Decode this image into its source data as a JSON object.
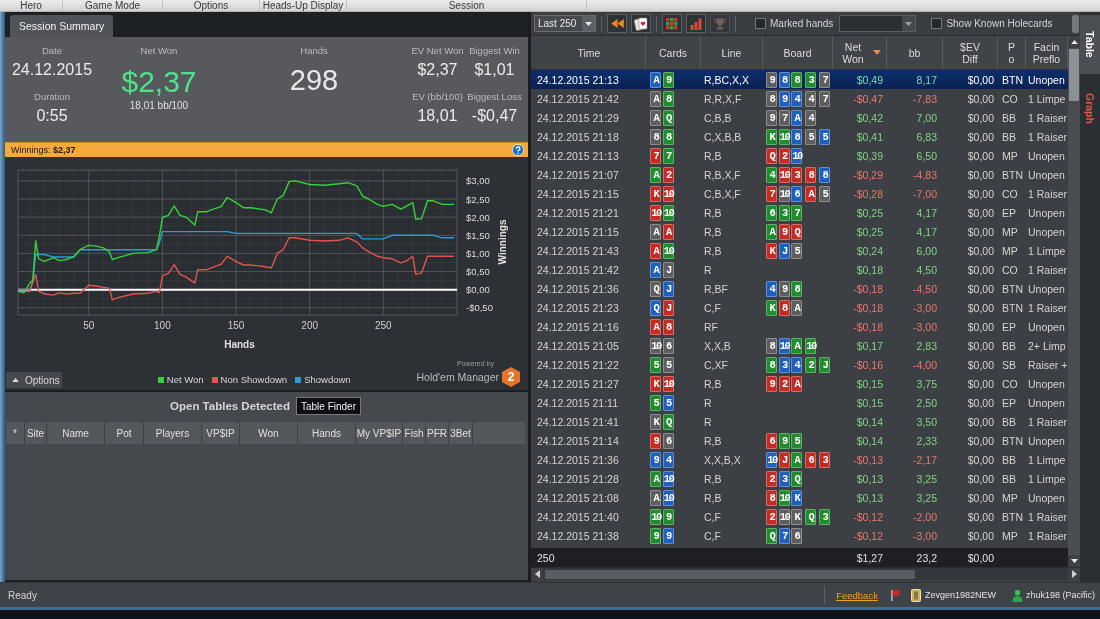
{
  "menu": [
    "Hero",
    "Game Mode",
    "Options",
    "Heads-Up Display",
    "Session"
  ],
  "tabs": [
    {
      "label": "Session Summary",
      "selected": true
    }
  ],
  "summary": {
    "date": {
      "label": "Date",
      "value": "24.12.2015"
    },
    "duration": {
      "label": "Duration",
      "value": "0:55"
    },
    "net_won": {
      "label": "Net Won",
      "value": "$2,37",
      "rate": "18,01 bb/100"
    },
    "hands": {
      "label": "Hands",
      "value": "298"
    },
    "ev_net_won": {
      "label": "EV Net Won",
      "value": "$2,37"
    },
    "ev_bb_100": {
      "label": "EV (bb/100)",
      "value": "18,01"
    },
    "biggest_win": {
      "label": "Biggest Win",
      "value": "$1,01"
    },
    "biggest_loss": {
      "label": "Biggest Loss",
      "value": "-$0,47"
    }
  },
  "winnings_bar": {
    "text": "Winnings: **$2,37**"
  },
  "chart": {
    "chart_data": {
      "type": "line",
      "xlabel": "Hands",
      "ylabel": "Winnings",
      "grid": true,
      "x": [
        2,
        6,
        10,
        12,
        14,
        16,
        20,
        26,
        30,
        35,
        40,
        44,
        50,
        55,
        60,
        64,
        66,
        70,
        80,
        90,
        96,
        98,
        100,
        104,
        108,
        112,
        116,
        122,
        124,
        130,
        140,
        144,
        150,
        155,
        160,
        170,
        174,
        178,
        182,
        186,
        190,
        200,
        210,
        220,
        226,
        232,
        236,
        240,
        246,
        250,
        256,
        262,
        266,
        270,
        272,
        276,
        280,
        284,
        290,
        298
      ],
      "series": [
        {
          "name": "Net Won",
          "color": "#35d13a",
          "values": [
            -0.05,
            -0.09,
            0.18,
            0.25,
            1.35,
            0.85,
            0.78,
            0.88,
            0.8,
            0.83,
            0.92,
            1.1,
            1.22,
            1.2,
            1.15,
            1.05,
            0.83,
            0.88,
            1.0,
            1.02,
            1.1,
            1.48,
            1.99,
            2.05,
            2.31,
            2.05,
            2.0,
            1.78,
            2.15,
            2.15,
            2.3,
            2.54,
            2.4,
            2.26,
            2.26,
            2.2,
            2.12,
            2.5,
            2.6,
            2.98,
            3.0,
            2.9,
            2.88,
            2.92,
            2.95,
            2.86,
            2.58,
            2.5,
            2.35,
            2.3,
            2.35,
            2.22,
            2.31,
            2.4,
            1.94,
            1.96,
            2.45,
            2.45,
            2.35,
            2.35
          ]
        },
        {
          "name": "Non Showdown",
          "color": "#e0554f",
          "values": [
            -0.05,
            -0.05,
            -0.05,
            0.2,
            0.42,
            -0.05,
            -0.12,
            -0.15,
            -0.09,
            -0.12,
            -0.1,
            -0.1,
            0.12,
            0.1,
            0.06,
            0.04,
            -0.28,
            -0.22,
            -0.12,
            -0.1,
            -0.05,
            -0.08,
            0.38,
            0.45,
            0.69,
            0.42,
            0.35,
            0.18,
            0.55,
            0.55,
            0.7,
            0.92,
            0.78,
            0.68,
            0.68,
            0.63,
            0.6,
            1.0,
            1.1,
            1.43,
            1.43,
            1.36,
            1.34,
            1.36,
            1.43,
            1.32,
            1.15,
            1.05,
            0.92,
            0.88,
            0.85,
            0.74,
            0.8,
            0.92,
            0.42,
            0.46,
            0.92,
            0.92,
            0.92,
            0.92
          ]
        },
        {
          "name": "Showdown",
          "color": "#2a9bd8",
          "values": [
            0,
            0,
            0,
            0.2,
            0.97,
            0.97,
            0.97,
            0.9,
            0.9,
            0.9,
            0.9,
            1.1,
            1.1,
            1.1,
            1.1,
            1.1,
            1.1,
            1.1,
            1.1,
            1.1,
            1.1,
            1.3,
            1.6,
            1.6,
            1.6,
            1.6,
            1.6,
            1.6,
            1.6,
            1.6,
            1.6,
            1.6,
            1.55,
            1.55,
            1.55,
            1.55,
            1.55,
            1.55,
            1.55,
            1.55,
            1.55,
            1.55,
            1.55,
            1.55,
            1.55,
            1.55,
            1.4,
            1.4,
            1.4,
            1.4,
            1.5,
            1.5,
            1.5,
            1.5,
            1.5,
            1.5,
            1.5,
            1.5,
            1.43,
            1.43
          ]
        }
      ],
      "xlim": [
        2,
        300
      ],
      "ylim": [
        -0.7,
        3.3
      ],
      "xticks": [
        50,
        100,
        150,
        200,
        250
      ],
      "yticks": [
        {
          "value": -0.5,
          "label": "-$0,50"
        },
        {
          "value": 0,
          "label": "$0,00"
        },
        {
          "value": 0.5,
          "label": "$0,50"
        },
        {
          "value": 1,
          "label": "$1,00"
        },
        {
          "value": 1.5,
          "label": "$1,50"
        },
        {
          "value": 2,
          "label": "$2,00"
        },
        {
          "value": 2.5,
          "label": "$2,50"
        },
        {
          "value": 3,
          "label": "$3,00"
        }
      ]
    },
    "options_button": {
      "label": "Options"
    },
    "branding": {
      "tagline": "Powered by",
      "name": "Hold'em Manager",
      "badge": "2"
    }
  },
  "open_tables": {
    "title": "Open Tables Detected",
    "finder_button": {
      "label": "Table Finder"
    },
    "columns": [
      "*",
      "Site",
      "Name",
      "Pot",
      "Players",
      "VP$IP",
      "Won",
      "Hands",
      "My VP$IP",
      "Fish",
      "PFR",
      "3Bet"
    ]
  },
  "hand_list": {
    "toolbar": {
      "range": {
        "value": "Last 250"
      },
      "icon_buttons": [
        {
          "disabled": false
        },
        {
          "disabled": false
        },
        {
          "disabled": false
        },
        {
          "disabled": false
        },
        {
          "disabled": true
        }
      ],
      "marked_hands": {
        "label": "Marked hands",
        "checked": false
      },
      "show_holecards": {
        "label": "Show Known Holecards",
        "checked": false
      }
    },
    "columns": [
      {
        "label": "Time",
        "sorted": false
      },
      {
        "label": "Cards",
        "sorted": false
      },
      {
        "label": "Line",
        "sorted": false
      },
      {
        "label": "Board",
        "sorted": false
      },
      {
        "label": "Net Won",
        "sorted": true
      },
      {
        "label": "bb",
        "sorted": false
      },
      {
        "label": "$EV Diff",
        "sorted": false
      },
      {
        "label": "Po",
        "sorted": false
      },
      {
        "label": "Facin Preflo",
        "sorted": false
      }
    ],
    "rows": [
      {
        "time": "24.12.2015 21:13",
        "hole_cards": [
          {
            "rank": "A",
            "color": "#1f5fbd"
          },
          {
            "rank": "9",
            "color": "#1f8d2b"
          }
        ],
        "line": "R,BC,X,X",
        "board": [
          {
            "rank": "9",
            "color": "#5e5e5e"
          },
          {
            "rank": "8",
            "color": "#1f5fbd"
          },
          {
            "rank": "8",
            "color": "#1f8d2b"
          },
          {
            "rank": "3",
            "color": "#1f8d2b"
          },
          {
            "rank": "7",
            "color": "#5e5e5e"
          }
        ],
        "net_won": "$0,49",
        "bb": "8,17",
        "ev_diff": "$0,00",
        "position": "BTN",
        "facing": "Unopen",
        "won": true,
        "selected": true
      },
      {
        "time": "24.12.2015 21:42",
        "hole_cards": [
          {
            "rank": "A",
            "color": "#5e5e5e"
          },
          {
            "rank": "8",
            "color": "#1f8d2b"
          }
        ],
        "line": "R,R,X,F",
        "board": [
          {
            "rank": "8",
            "color": "#5e5e5e"
          },
          {
            "rank": "9",
            "color": "#1f5fbd"
          },
          {
            "rank": "4",
            "color": "#1f5fbd"
          },
          {
            "rank": "4",
            "color": "#5e5e5e"
          },
          {
            "rank": "7",
            "color": "#5e5e5e"
          }
        ],
        "net_won": "-$0,47",
        "bb": "-7,83",
        "ev_diff": "$0,00",
        "position": "CO",
        "facing": "1 Limpe",
        "won": false,
        "selected": false
      },
      {
        "time": "24.12.2015 21:29",
        "hole_cards": [
          {
            "rank": "A",
            "color": "#5e5e5e"
          },
          {
            "rank": "Q",
            "color": "#1f8d2b"
          }
        ],
        "line": "C,B,B",
        "board": [
          {
            "rank": "9",
            "color": "#5e5e5e"
          },
          {
            "rank": "7",
            "color": "#5e5e5e"
          },
          {
            "rank": "A",
            "color": "#1f5fbd"
          },
          {
            "rank": "4",
            "color": "#5e5e5e"
          }
        ],
        "net_won": "$0,42",
        "bb": "7,00",
        "ev_diff": "$0,00",
        "position": "BB",
        "facing": "1 Raiser",
        "won": true,
        "selected": false
      },
      {
        "time": "24.12.2015 21:18",
        "hole_cards": [
          {
            "rank": "8",
            "color": "#5e5e5e"
          },
          {
            "rank": "8",
            "color": "#1f8d2b"
          }
        ],
        "line": "C,X,B,B",
        "board": [
          {
            "rank": "K",
            "color": "#1f8d2b"
          },
          {
            "rank": "10",
            "color": "#1f8d2b"
          },
          {
            "rank": "8",
            "color": "#1f5fbd"
          },
          {
            "rank": "5",
            "color": "#5e5e5e"
          },
          {
            "rank": "5",
            "color": "#1f5fbd"
          }
        ],
        "net_won": "$0,41",
        "bb": "6,83",
        "ev_diff": "$0,00",
        "position": "BB",
        "facing": "1 Raiser",
        "won": true,
        "selected": false
      },
      {
        "time": "24.12.2015 21:13",
        "hole_cards": [
          {
            "rank": "7",
            "color": "#c62b23"
          },
          {
            "rank": "7",
            "color": "#1f8d2b"
          }
        ],
        "line": "R,B",
        "board": [
          {
            "rank": "Q",
            "color": "#c62b23"
          },
          {
            "rank": "2",
            "color": "#c62b23"
          },
          {
            "rank": "10",
            "color": "#1f5fbd"
          }
        ],
        "net_won": "$0,39",
        "bb": "6,50",
        "ev_diff": "$0,00",
        "position": "MP",
        "facing": "Unopen",
        "won": true,
        "selected": false
      },
      {
        "time": "24.12.2015 21:07",
        "hole_cards": [
          {
            "rank": "A",
            "color": "#1f8d2b"
          },
          {
            "rank": "2",
            "color": "#c62b23"
          }
        ],
        "line": "R,B,X,F",
        "board": [
          {
            "rank": "4",
            "color": "#1f8d2b"
          },
          {
            "rank": "10",
            "color": "#c62b23"
          },
          {
            "rank": "3",
            "color": "#c62b23"
          },
          {
            "rank": "8",
            "color": "#c62b23"
          },
          {
            "rank": "8",
            "color": "#1f5fbd"
          }
        ],
        "net_won": "-$0,29",
        "bb": "-4,83",
        "ev_diff": "$0,00",
        "position": "BTN",
        "facing": "Unopen",
        "won": false,
        "selected": false
      },
      {
        "time": "24.12.2015 21:15",
        "hole_cards": [
          {
            "rank": "K",
            "color": "#c62b23"
          },
          {
            "rank": "10",
            "color": "#c62b23"
          }
        ],
        "line": "C,B,X,F",
        "board": [
          {
            "rank": "7",
            "color": "#c62b23"
          },
          {
            "rank": "10",
            "color": "#5e5e5e"
          },
          {
            "rank": "6",
            "color": "#1f5fbd"
          },
          {
            "rank": "A",
            "color": "#c62b23"
          },
          {
            "rank": "5",
            "color": "#5e5e5e"
          }
        ],
        "net_won": "-$0,28",
        "bb": "-7,00",
        "ev_diff": "$0,00",
        "position": "CO",
        "facing": "1 Raiser",
        "won": false,
        "selected": false
      },
      {
        "time": "24.12.2015 21:21",
        "hole_cards": [
          {
            "rank": "10",
            "color": "#c62b23"
          },
          {
            "rank": "10",
            "color": "#1f8d2b"
          }
        ],
        "line": "R,B",
        "board": [
          {
            "rank": "6",
            "color": "#1f8d2b"
          },
          {
            "rank": "3",
            "color": "#1f8d2b"
          },
          {
            "rank": "7",
            "color": "#1f8d2b"
          }
        ],
        "net_won": "$0,25",
        "bb": "4,17",
        "ev_diff": "$0,00",
        "position": "EP",
        "facing": "Unopen",
        "won": true,
        "selected": false
      },
      {
        "time": "24.12.2015 21:15",
        "hole_cards": [
          {
            "rank": "A",
            "color": "#5e5e5e"
          },
          {
            "rank": "A",
            "color": "#c62b23"
          }
        ],
        "line": "R,B",
        "board": [
          {
            "rank": "A",
            "color": "#1f8d2b"
          },
          {
            "rank": "9",
            "color": "#c62b23"
          },
          {
            "rank": "Q",
            "color": "#c62b23"
          }
        ],
        "net_won": "$0,25",
        "bb": "4,17",
        "ev_diff": "$0,00",
        "position": "MP",
        "facing": "Unopen",
        "won": true,
        "selected": false
      },
      {
        "time": "24.12.2015 21:43",
        "hole_cards": [
          {
            "rank": "A",
            "color": "#c62b23"
          },
          {
            "rank": "10",
            "color": "#1f8d2b"
          }
        ],
        "line": "R,B",
        "board": [
          {
            "rank": "K",
            "color": "#c62b23"
          },
          {
            "rank": "J",
            "color": "#1f5fbd"
          },
          {
            "rank": "5",
            "color": "#5e5e5e"
          }
        ],
        "net_won": "$0,24",
        "bb": "6,00",
        "ev_diff": "$0,00",
        "position": "MP",
        "facing": "1 Limpe",
        "won": true,
        "selected": false
      },
      {
        "time": "24.12.2015 21:42",
        "hole_cards": [
          {
            "rank": "A",
            "color": "#1f5fbd"
          },
          {
            "rank": "J",
            "color": "#5e5e5e"
          }
        ],
        "line": "R",
        "net_won": "$0,18",
        "bb": "4,50",
        "ev_diff": "$0,00",
        "position": "CO",
        "facing": "1 Raiser",
        "won": true,
        "selected": false
      },
      {
        "time": "24.12.2015 21:36",
        "hole_cards": [
          {
            "rank": "Q",
            "color": "#5e5e5e"
          },
          {
            "rank": "J",
            "color": "#1f5fbd"
          }
        ],
        "line": "R,BF",
        "board": [
          {
            "rank": "4",
            "color": "#1f5fbd"
          },
          {
            "rank": "9",
            "color": "#5e5e5e"
          },
          {
            "rank": "8",
            "color": "#1f8d2b"
          }
        ],
        "net_won": "-$0,18",
        "bb": "-4,50",
        "ev_diff": "$0,00",
        "position": "BTN",
        "facing": "Unopen",
        "won": false,
        "selected": false
      },
      {
        "time": "24.12.2015 21:23",
        "hole_cards": [
          {
            "rank": "Q",
            "color": "#1f5fbd"
          },
          {
            "rank": "J",
            "color": "#c62b23"
          }
        ],
        "line": "C,F",
        "board": [
          {
            "rank": "K",
            "color": "#1f8d2b"
          },
          {
            "rank": "8",
            "color": "#c62b23"
          },
          {
            "rank": "A",
            "color": "#5e5e5e"
          }
        ],
        "net_won": "-$0,18",
        "bb": "-3,00",
        "ev_diff": "$0,00",
        "position": "BTN",
        "facing": "1 Raiser",
        "won": false,
        "selected": false
      },
      {
        "time": "24.12.2015 21:16",
        "hole_cards": [
          {
            "rank": "A",
            "color": "#c62b23"
          },
          {
            "rank": "8",
            "color": "#c62b23"
          }
        ],
        "line": "RF",
        "net_won": "-$0,18",
        "bb": "-3,00",
        "ev_diff": "$0,00",
        "position": "EP",
        "facing": "Unopen",
        "won": false,
        "selected": false
      },
      {
        "time": "24.12.2015 21:05",
        "hole_cards": [
          {
            "rank": "10",
            "color": "#5e5e5e"
          },
          {
            "rank": "6",
            "color": "#5e5e5e"
          }
        ],
        "line": "X,X,B",
        "board": [
          {
            "rank": "8",
            "color": "#5e5e5e"
          },
          {
            "rank": "10",
            "color": "#1f5fbd"
          },
          {
            "rank": "A",
            "color": "#1f8d2b"
          },
          {
            "rank": "10",
            "color": "#1f8d2b"
          }
        ],
        "net_won": "$0,17",
        "bb": "2,83",
        "ev_diff": "$0,00",
        "position": "BB",
        "facing": "2+ Limp",
        "won": true,
        "selected": false
      },
      {
        "time": "24.12.2015 21:22",
        "hole_cards": [
          {
            "rank": "5",
            "color": "#1f8d2b"
          },
          {
            "rank": "5",
            "color": "#5e5e5e"
          }
        ],
        "line": "C,XF",
        "board": [
          {
            "rank": "8",
            "color": "#1f8d2b"
          },
          {
            "rank": "3",
            "color": "#1f5fbd"
          },
          {
            "rank": "4",
            "color": "#1f5fbd"
          },
          {
            "rank": "2",
            "color": "#1f8d2b"
          },
          {
            "rank": "J",
            "color": "#1f8d2b"
          }
        ],
        "net_won": "-$0,16",
        "bb": "-4,00",
        "ev_diff": "$0,00",
        "position": "SB",
        "facing": "Raiser +",
        "won": false,
        "selected": false
      },
      {
        "time": "24.12.2015 21:27",
        "hole_cards": [
          {
            "rank": "K",
            "color": "#c62b23"
          },
          {
            "rank": "10",
            "color": "#c62b23"
          }
        ],
        "line": "R,B",
        "board": [
          {
            "rank": "9",
            "color": "#c62b23"
          },
          {
            "rank": "2",
            "color": "#c62b23"
          },
          {
            "rank": "A",
            "color": "#c62b23"
          }
        ],
        "net_won": "$0,15",
        "bb": "3,75",
        "ev_diff": "$0,00",
        "position": "CO",
        "facing": "Unopen",
        "won": true,
        "selected": false
      },
      {
        "time": "24.12.2015 21:11",
        "hole_cards": [
          {
            "rank": "5",
            "color": "#1f8d2b"
          },
          {
            "rank": "5",
            "color": "#1f5fbd"
          }
        ],
        "line": "R",
        "net_won": "$0,15",
        "bb": "2,50",
        "ev_diff": "$0,00",
        "position": "EP",
        "facing": "Unopen",
        "won": true,
        "selected": false
      },
      {
        "time": "24.12.2015 21:41",
        "hole_cards": [
          {
            "rank": "K",
            "color": "#5e5e5e"
          },
          {
            "rank": "Q",
            "color": "#1f8d2b"
          }
        ],
        "line": "R",
        "net_won": "$0,14",
        "bb": "3,50",
        "ev_diff": "$0,00",
        "position": "BB",
        "facing": "1 Raiser",
        "won": true,
        "selected": false
      },
      {
        "time": "24.12.2015 21:14",
        "hole_cards": [
          {
            "rank": "9",
            "color": "#c62b23"
          },
          {
            "rank": "6",
            "color": "#5e5e5e"
          }
        ],
        "line": "R,B",
        "board": [
          {
            "rank": "6",
            "color": "#c62b23"
          },
          {
            "rank": "9",
            "color": "#1f8d2b"
          },
          {
            "rank": "5",
            "color": "#1f8d2b"
          }
        ],
        "net_won": "$0,14",
        "bb": "2,33",
        "ev_diff": "$0,00",
        "position": "BTN",
        "facing": "Unopen",
        "won": true,
        "selected": false
      },
      {
        "time": "24.12.2015 21:36",
        "hole_cards": [
          {
            "rank": "9",
            "color": "#1f5fbd"
          },
          {
            "rank": "4",
            "color": "#1f5fbd"
          }
        ],
        "line": "X,X,B,X",
        "board": [
          {
            "rank": "10",
            "color": "#1f5fbd"
          },
          {
            "rank": "J",
            "color": "#c62b23"
          },
          {
            "rank": "A",
            "color": "#1f8d2b"
          },
          {
            "rank": "6",
            "color": "#c62b23"
          },
          {
            "rank": "3",
            "color": "#c62b23"
          }
        ],
        "net_won": "-$0,13",
        "bb": "-2,17",
        "ev_diff": "$0,00",
        "position": "BB",
        "facing": "1 Limpe",
        "won": false,
        "selected": false
      },
      {
        "time": "24.12.2015 21:28",
        "hole_cards": [
          {
            "rank": "A",
            "color": "#1f8d2b"
          },
          {
            "rank": "10",
            "color": "#1f5fbd"
          }
        ],
        "line": "R,B",
        "board": [
          {
            "rank": "2",
            "color": "#c62b23"
          },
          {
            "rank": "3",
            "color": "#1f5fbd"
          },
          {
            "rank": "Q",
            "color": "#1f8d2b"
          }
        ],
        "net_won": "$0,13",
        "bb": "3,25",
        "ev_diff": "$0,00",
        "position": "BB",
        "facing": "1 Limpe",
        "won": true,
        "selected": false
      },
      {
        "time": "24.12.2015 21:08",
        "hole_cards": [
          {
            "rank": "A",
            "color": "#5e5e5e"
          },
          {
            "rank": "10",
            "color": "#1f5fbd"
          }
        ],
        "line": "R,B",
        "board": [
          {
            "rank": "8",
            "color": "#c62b23"
          },
          {
            "rank": "10",
            "color": "#1f8d2b"
          },
          {
            "rank": "K",
            "color": "#1f5fbd"
          }
        ],
        "net_won": "$0,13",
        "bb": "3,25",
        "ev_diff": "$0,00",
        "position": "MP",
        "facing": "Unopen",
        "won": true,
        "selected": false
      },
      {
        "time": "24.12.2015 21:40",
        "hole_cards": [
          {
            "rank": "10",
            "color": "#1f8d2b"
          },
          {
            "rank": "9",
            "color": "#1f8d2b"
          }
        ],
        "line": "C,F",
        "board": [
          {
            "rank": "2",
            "color": "#c62b23"
          },
          {
            "rank": "10",
            "color": "#5e5e5e"
          },
          {
            "rank": "K",
            "color": "#5e5e5e"
          },
          {
            "rank": "Q",
            "color": "#1f8d2b"
          },
          {
            "rank": "3",
            "color": "#1f8d2b"
          }
        ],
        "net_won": "-$0,12",
        "bb": "-2,00",
        "ev_diff": "$0,00",
        "position": "BTN",
        "facing": "1 Raiser",
        "won": false,
        "selected": false
      },
      {
        "time": "24.12.2015 21:38",
        "hole_cards": [
          {
            "rank": "9",
            "color": "#1f8d2b"
          },
          {
            "rank": "9",
            "color": "#1f5fbd"
          }
        ],
        "line": "C,F",
        "board": [
          {
            "rank": "Q",
            "color": "#1f8d2b"
          },
          {
            "rank": "7",
            "color": "#1f5fbd"
          },
          {
            "rank": "6",
            "color": "#5e5e5e"
          }
        ],
        "net_won": "-$0,12",
        "bb": "-3,00",
        "ev_diff": "$0,00",
        "position": "MP",
        "facing": "1 Raiser",
        "won": false,
        "selected": false
      }
    ],
    "totals": {
      "count": "250",
      "net_won": "$1,27",
      "bb": "23,2",
      "ev_diff": "$0,00"
    }
  },
  "view_tabs": [
    {
      "label": "Table",
      "selected": true
    },
    {
      "label": "Graph",
      "selected": false
    }
  ],
  "status_bar": {
    "text": "Ready",
    "feedback_link": "Feedback",
    "site_user": "Zevgen1982NEW",
    "player": "zhuk198 (Pacific)"
  }
}
